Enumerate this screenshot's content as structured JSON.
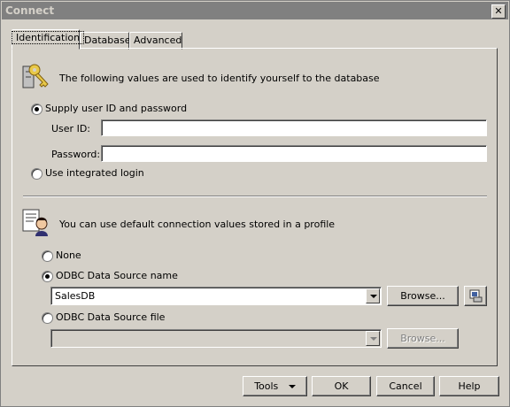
{
  "window": {
    "title": "Connect",
    "close_label": "✕"
  },
  "tabs": [
    {
      "label": "Identification"
    },
    {
      "label": "Database"
    },
    {
      "label": "Advanced"
    }
  ],
  "identification": {
    "intro": "The following values are used to identify yourself to the database",
    "supply_label": "Supply user ID and password",
    "userid_label": "User ID:",
    "userid_value": "",
    "password_label": "Password:",
    "password_value": "",
    "integrated_label": "Use integrated login"
  },
  "profile": {
    "intro": "You can use default connection values stored in a profile",
    "none_label": "None",
    "odbc_name_label": "ODBC Data Source name",
    "odbc_name_value": "SalesDB",
    "browse_label": "Browse...",
    "odbc_file_label": "ODBC Data Source file",
    "odbc_file_value": "",
    "browse2_label": "Browse..."
  },
  "footer": {
    "tools_label": "Tools",
    "ok_label": "OK",
    "cancel_label": "Cancel",
    "help_label": "Help"
  }
}
